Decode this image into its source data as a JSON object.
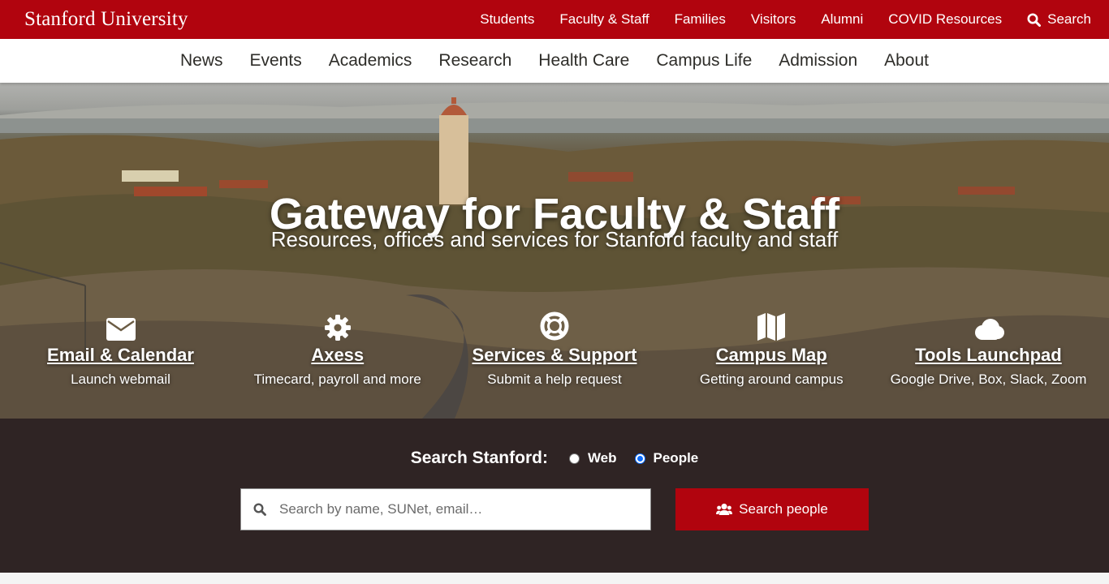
{
  "site": {
    "wordmark": "Stanford University"
  },
  "audience_nav": {
    "items": [
      "Students",
      "Faculty & Staff",
      "Families",
      "Visitors",
      "Alumni",
      "COVID Resources"
    ],
    "search_label": "Search"
  },
  "main_nav": {
    "items": [
      "News",
      "Events",
      "Academics",
      "Research",
      "Health Care",
      "Campus Life",
      "Admission",
      "About"
    ]
  },
  "hero": {
    "title": "Gateway for Faculty & Staff",
    "subtitle": "Resources, offices and services for Stanford faculty and staff"
  },
  "quick_links": [
    {
      "title": "Email & Calendar",
      "description": "Launch webmail",
      "icon": "envelope-icon"
    },
    {
      "title": "Axess",
      "description": "Timecard, payroll and more",
      "icon": "gear-icon"
    },
    {
      "title": "Services & Support",
      "description": "Submit a help request",
      "icon": "lifering-icon"
    },
    {
      "title": "Campus Map",
      "description": "Getting around campus",
      "icon": "map-icon"
    },
    {
      "title": "Tools Launchpad",
      "description": "Google Drive, Box, Slack, Zoom",
      "icon": "cloud-icon"
    }
  ],
  "search": {
    "label": "Search Stanford:",
    "options": [
      {
        "label": "Web",
        "selected": false
      },
      {
        "label": "People",
        "selected": true
      }
    ],
    "placeholder": "Search by name, SUNet, email…",
    "value": "",
    "button_label": "Search people"
  },
  "colors": {
    "cardinal_red": "#b1040e",
    "search_bg": "#2f2424",
    "radio_accent": "#0a6cff"
  }
}
